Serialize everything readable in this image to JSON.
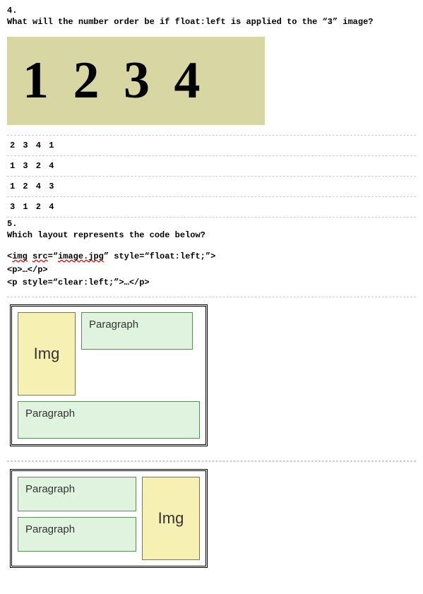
{
  "q4": {
    "number": "4.",
    "text": "What will the number order be if float:left is applied to the “3” image?",
    "numbers": "1 2 3 4",
    "answers": [
      "2 3 4 1",
      "1 3 2 4",
      "1 2 4 3",
      "3 1 2 4"
    ]
  },
  "q5": {
    "number": "5.",
    "text": "Which layout represents the code below?",
    "code": {
      "line1_pre": "<",
      "line1_img": "img",
      "line1_mid": " ",
      "line1_src": "src",
      "line1_eq1": "=“",
      "line1_file": "image.jpg",
      "line1_post": "” style=“float:left;”>",
      "line2": "<p>…</p>",
      "line3": "<p style=“clear:left;”>…</p>"
    },
    "labels": {
      "img": "Img",
      "paragraph": "Paragraph"
    }
  }
}
